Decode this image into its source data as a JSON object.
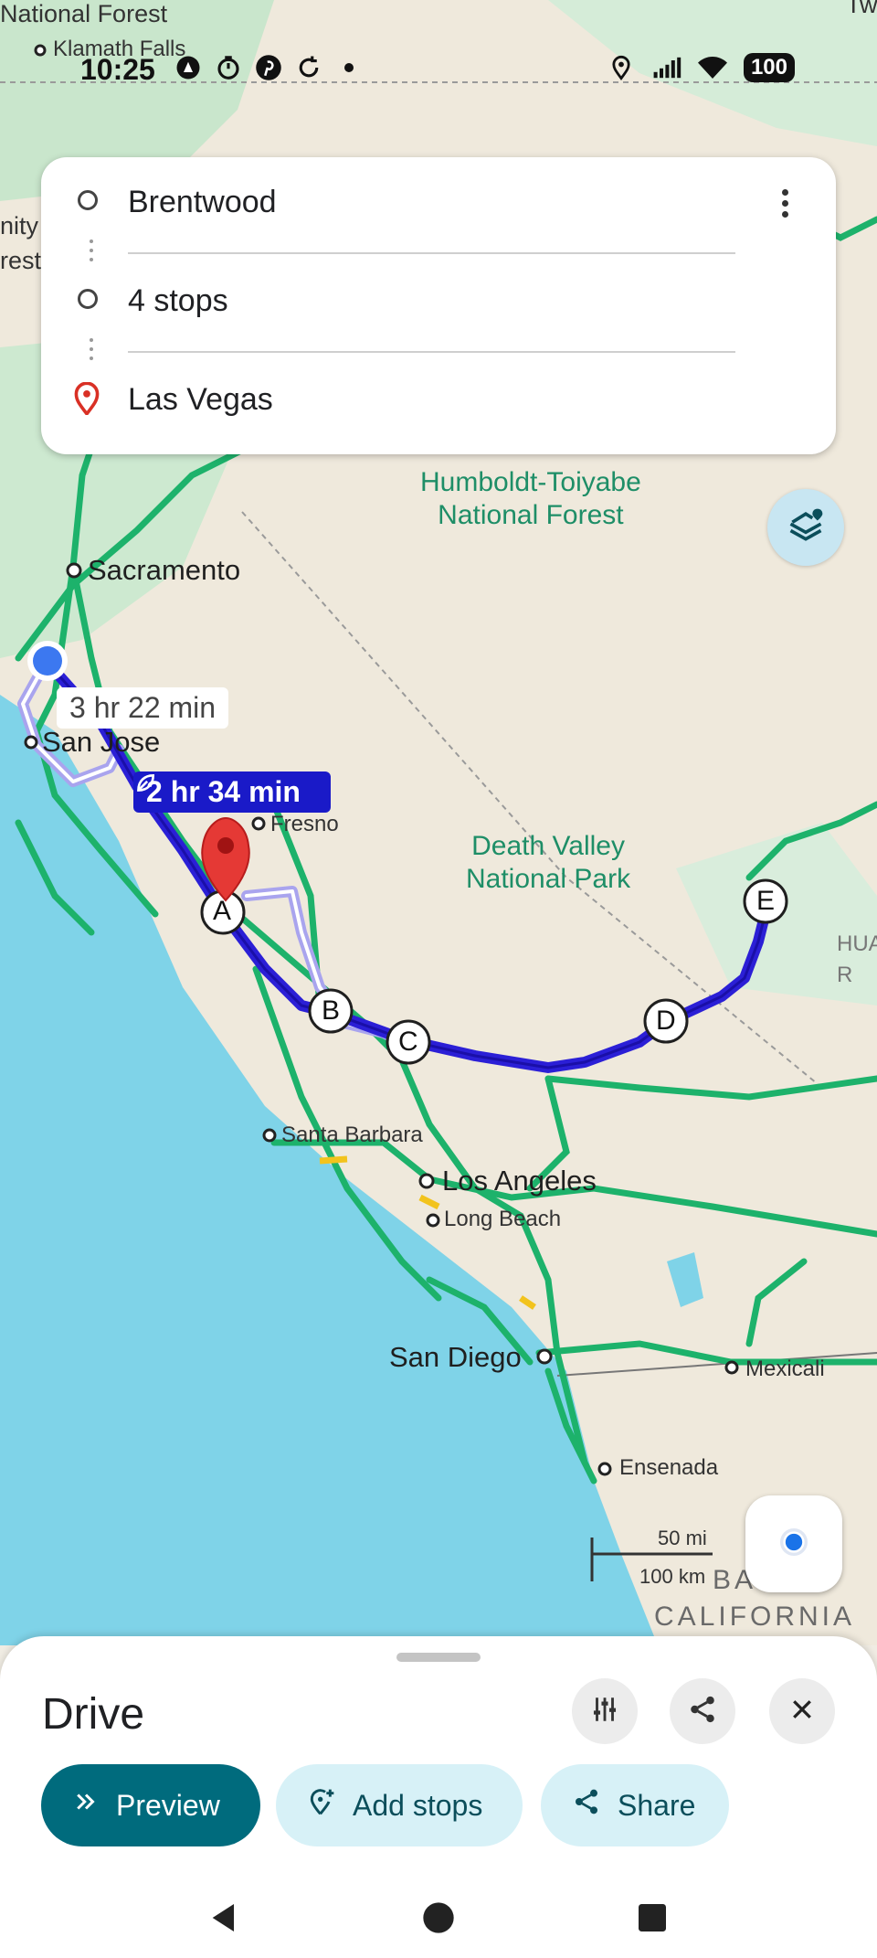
{
  "status_bar": {
    "time": "10:25",
    "battery": "100",
    "icons_left": [
      "maps-navigation-icon",
      "timer-icon",
      "pinterest-icon",
      "sync-icon",
      "dot-icon"
    ],
    "icons_right": [
      "location-icon",
      "signal-icon",
      "wifi-icon",
      "battery-icon"
    ]
  },
  "route_card": {
    "origin": "Brentwood",
    "stops": "4 stops",
    "destination": "Las Vegas"
  },
  "map": {
    "time_alt": "3 hr 22 min",
    "time_best": "2 hr 34 min",
    "labels": {
      "national_forest": "National Forest",
      "klamath": "Klamath Falls",
      "nity": "nity",
      "est": "rest",
      "tw": "Tw",
      "humboldt": "Humboldt-Toiyabe\nNational Forest",
      "sacramento": "Sacramento",
      "san_jose": "San Jose",
      "fresno": "Fresno",
      "death_valley": "Death Valley\nNational Park",
      "hua": "HUA\nR",
      "santa_barbara": "Santa Barbara",
      "los_angeles": "Los Angeles",
      "long_beach": "Long Beach",
      "san_diego": "San Diego",
      "mexicali": "Mexicali",
      "ensenada": "Ensenada",
      "scale_mi": "50 mi",
      "scale_km": "100 km",
      "ba": "BA",
      "california": "CALIFORNIA"
    },
    "stops": [
      "A",
      "B",
      "C",
      "D",
      "E"
    ],
    "colors": {
      "route_primary": "#2b1fd6",
      "route_alt": "#a9a4ee",
      "road": "#1db26b",
      "water": "#7fd3e8"
    }
  },
  "sheet": {
    "title": "Drive",
    "preview_label": "Preview",
    "add_stops_label": "Add stops",
    "share_label": "Share"
  }
}
